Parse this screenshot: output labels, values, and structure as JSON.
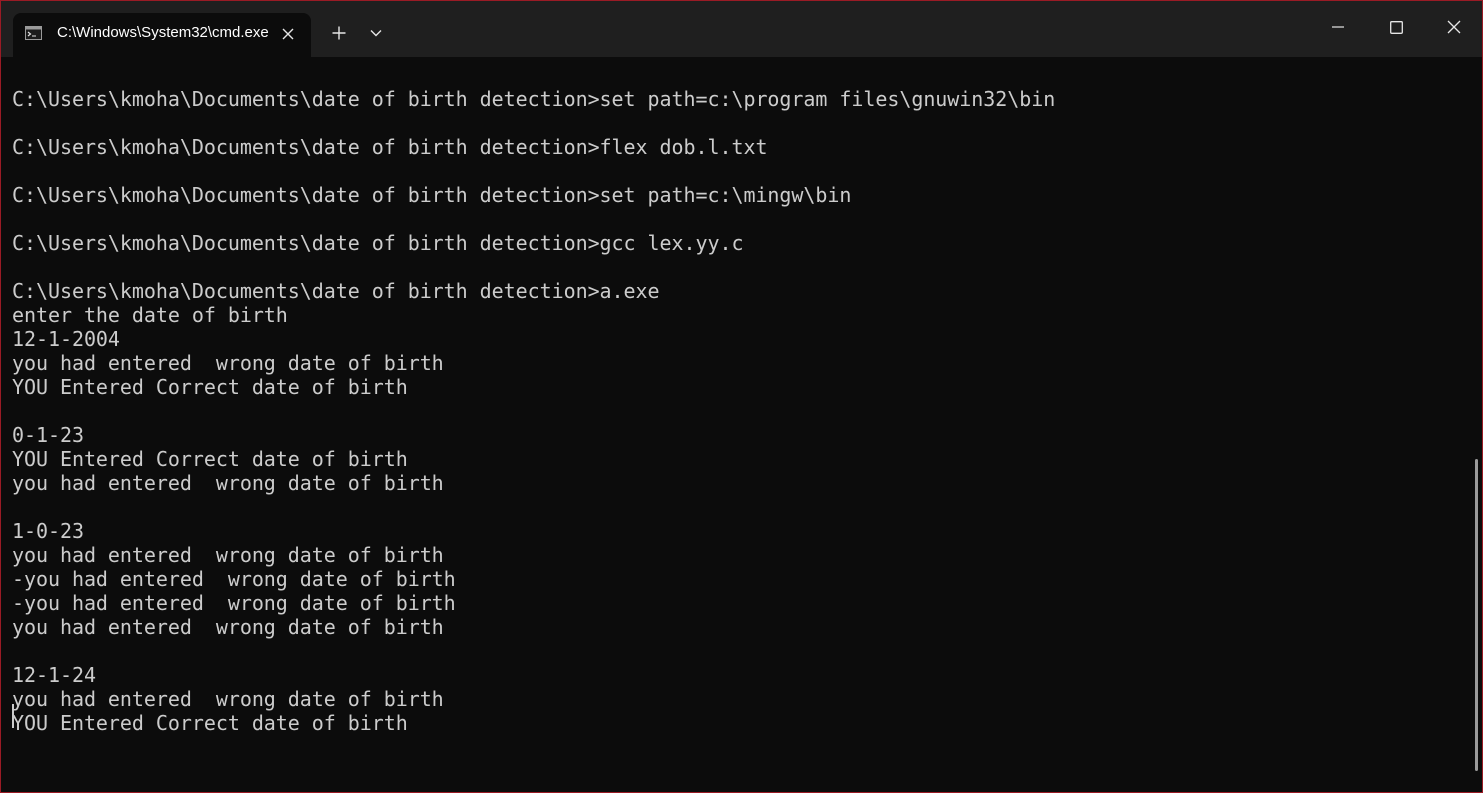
{
  "window": {
    "tab_title": "C:\\Windows\\System32\\cmd.exe",
    "new_tab_symbol": "+",
    "icons": {
      "tab": "terminal-icon",
      "tab_close": "close-icon",
      "new_tab": "plus-icon",
      "dropdown": "chevron-down-icon",
      "minimize": "minimize-icon",
      "maximize": "maximize-icon",
      "close": "close-icon"
    },
    "colors": {
      "frame_border": "#9a1b25",
      "titlebar": "#1f1f1f",
      "background": "#0c0c0c",
      "text": "#cccccc"
    }
  },
  "terminal": {
    "lines": [
      "C:\\Users\\kmoha\\Documents\\date of birth detection>set path=c:\\program files\\gnuwin32\\bin",
      "",
      "C:\\Users\\kmoha\\Documents\\date of birth detection>flex dob.l.txt",
      "",
      "C:\\Users\\kmoha\\Documents\\date of birth detection>set path=c:\\mingw\\bin",
      "",
      "C:\\Users\\kmoha\\Documents\\date of birth detection>gcc lex.yy.c",
      "",
      "C:\\Users\\kmoha\\Documents\\date of birth detection>a.exe",
      "enter the date of birth",
      "12-1-2004",
      "you had entered  wrong date of birth",
      "YOU Entered Correct date of birth",
      "",
      "0-1-23",
      "YOU Entered Correct date of birth",
      "you had entered  wrong date of birth",
      "",
      "1-0-23",
      "you had entered  wrong date of birth",
      "-you had entered  wrong date of birth",
      "-you had entered  wrong date of birth",
      "you had entered  wrong date of birth",
      "",
      "12-1-24",
      "you had entered  wrong date of birth",
      "YOU Entered Correct date of birth"
    ]
  }
}
